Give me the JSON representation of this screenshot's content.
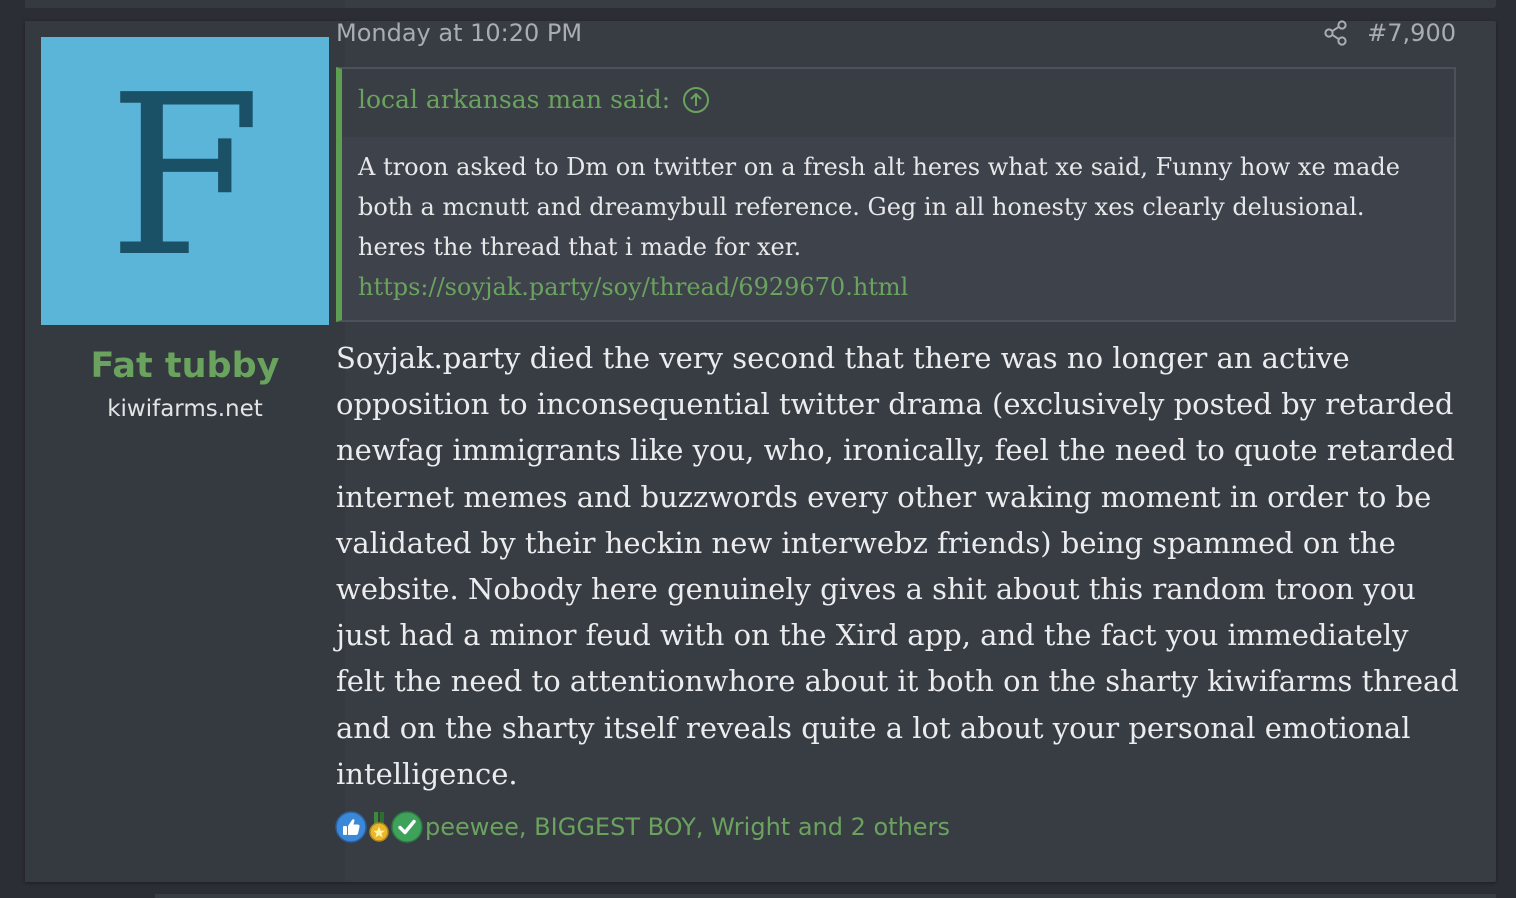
{
  "user": {
    "avatar_letter": "F",
    "name": "Fat tubby",
    "title": "kiwifarms.net"
  },
  "post": {
    "date": "Monday at 10:20 PM",
    "number": "#7,900",
    "share_icon": "share-icon"
  },
  "quote": {
    "attribution": "local arkansas man said:",
    "text": "A troon asked to Dm on twitter on a fresh alt heres what xe said, Funny how xe made both a mcnutt and dreamybull reference. Geg in all honesty xes clearly delusional. heres the thread that i made for xer.",
    "link": "https://soyjak.party/soy/thread/6929670.html",
    "icon": "arrow-up-circle-icon"
  },
  "body": "Soyjak.party died the very second that there was no longer an active opposition to inconsequential twitter drama (exclusively posted by retarded newfag immigrants like you, who, ironically, feel the need to quote retarded internet memes and buzzwords every other waking moment in order to be validated by their heckin new interwebz friends) being spammed on the website. Nobody here genuinely gives a shit about this random troon you just had a minor feud with on the Xird app, and the fact you immediately felt the need to attentionwhore about it both on the sharty kiwifarms thread and on the sharty itself reveals quite a lot about your personal emotional intelligence.",
  "reactions": {
    "icons": [
      "thumbs-up-icon",
      "winner-medal-icon",
      "checkmark-icon"
    ],
    "users": "peewee, BIGGEST BOY, Wright and 2 others"
  },
  "colors": {
    "accent_green": "#6aa35e",
    "avatar_bg": "#5bb5d9",
    "avatar_letter": "#1b5166",
    "post_bg": "#383c43",
    "user_cell_bg": "#353940"
  }
}
